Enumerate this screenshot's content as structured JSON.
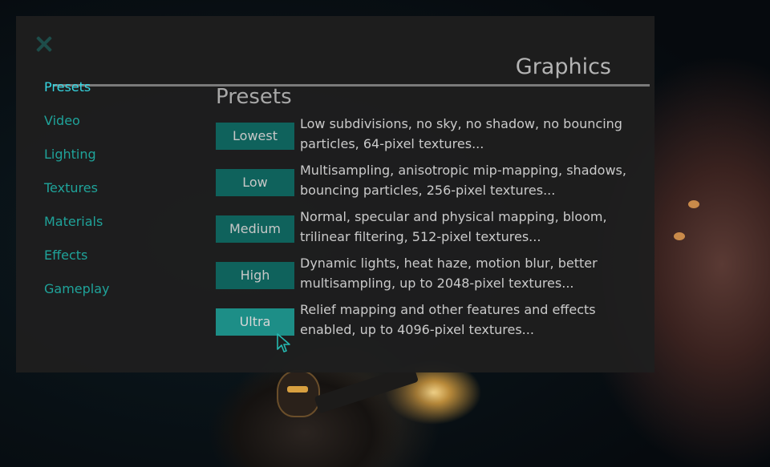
{
  "dialog": {
    "title": "Graphics",
    "close_icon": "close-icon"
  },
  "nav": {
    "items": [
      {
        "label": "Presets",
        "active": true
      },
      {
        "label": "Video"
      },
      {
        "label": "Lighting"
      },
      {
        "label": "Textures"
      },
      {
        "label": "Materials"
      },
      {
        "label": "Effects"
      },
      {
        "label": "Gameplay"
      }
    ]
  },
  "section": {
    "title": "Presets"
  },
  "presets": [
    {
      "label": "Lowest",
      "description": "Low subdivisions, no sky, no shadow, no bouncing particles, 64-pixel textures..."
    },
    {
      "label": "Low",
      "description": "Multisampling, anisotropic mip-mapping, shadows, bouncing particles, 256-pixel textures..."
    },
    {
      "label": "Medium",
      "description": "Normal, specular and physical mapping, bloom, trilinear filtering, 512-pixel textures..."
    },
    {
      "label": "High",
      "description": "Dynamic lights, heat haze, motion blur, better multisampling, up to 2048-pixel textures..."
    },
    {
      "label": "Ultra",
      "description": "Relief mapping and other features and effects enabled, up to 4096-pixel textures...",
      "hovered": true
    }
  ],
  "colors": {
    "accent_active": "#36d8e4",
    "accent": "#1fa39a",
    "button": "#0f625c",
    "button_hover": "#1d8e87",
    "panel": "#1e1e1e"
  }
}
